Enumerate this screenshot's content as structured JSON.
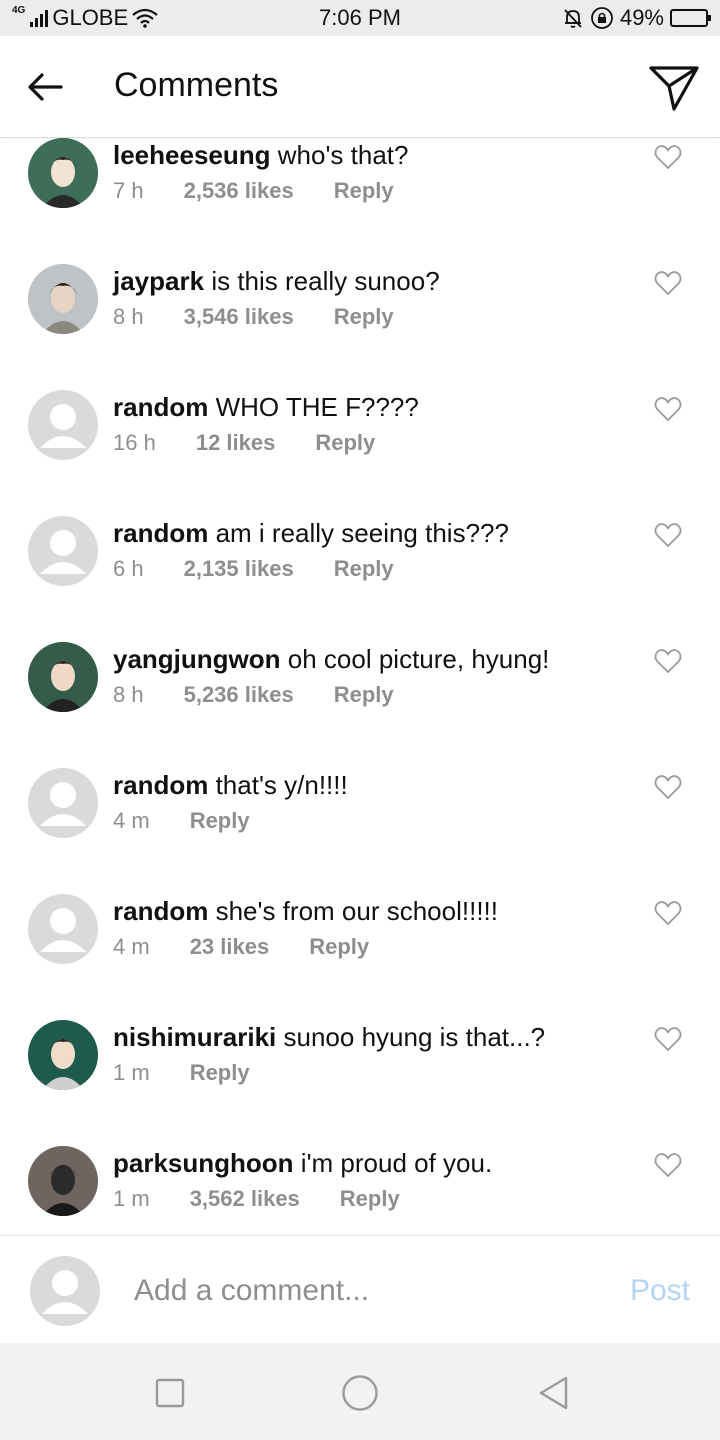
{
  "status_bar": {
    "network_type": "4G",
    "carrier": "GLOBE",
    "time": "7:06 PM",
    "battery": "49%",
    "battery_level": 0.49,
    "icons": [
      "signal-icon",
      "wifi-icon",
      "alarm-off-icon",
      "rotation-lock-icon",
      "battery-icon"
    ]
  },
  "header": {
    "title": "Comments",
    "back_icon": "arrow-left-icon",
    "send_icon": "direct-send-icon"
  },
  "comments": [
    {
      "username": "leeheeseung",
      "text": "who's that?",
      "time": "7 h",
      "likes": "2,536 likes",
      "reply": "Reply",
      "avatar": "photo-avatar"
    },
    {
      "username": "jaypark",
      "text": "is this really sunoo?",
      "time": "8 h",
      "likes": "3,546 likes",
      "reply": "Reply",
      "avatar": "photo-avatar"
    },
    {
      "username": "random",
      "text": "WHO THE F????",
      "time": "16 h",
      "likes": "12 likes",
      "reply": "Reply",
      "avatar": "default-avatar"
    },
    {
      "username": "random",
      "text": "am i really seeing this???",
      "time": "6 h",
      "likes": "2,135 likes",
      "reply": "Reply",
      "avatar": "default-avatar"
    },
    {
      "username": "yangjungwon",
      "text": "oh cool picture, hyung!",
      "time": "8 h",
      "likes": "5,236 likes",
      "reply": "Reply",
      "avatar": "photo-avatar"
    },
    {
      "username": "random",
      "text": "that's y/n!!!!",
      "time": "4 m",
      "likes": "",
      "reply": "Reply",
      "avatar": "default-avatar"
    },
    {
      "username": "random",
      "text": "she's from our school!!!!!",
      "time": "4 m",
      "likes": "23 likes",
      "reply": "Reply",
      "avatar": "default-avatar"
    },
    {
      "username": "nishimurariki",
      "text": "sunoo hyung is that...?",
      "time": "1 m",
      "likes": "",
      "reply": "Reply",
      "avatar": "photo-avatar"
    },
    {
      "username": "parksunghoon",
      "text": "i'm proud of you.",
      "time": "1 m",
      "likes": "3,562 likes",
      "reply": "Reply",
      "avatar": "photo-avatar"
    }
  ],
  "composer": {
    "placeholder": "Add a comment...",
    "post_label": "Post",
    "post_color": "#b3d4f5"
  },
  "nav_bar": {
    "icons": [
      "recents-square-icon",
      "home-circle-icon",
      "back-triangle-icon"
    ]
  },
  "colors": {
    "meta_gray": "#8e8e8e",
    "text": "#111111",
    "status_bar_bg": "#ececec",
    "nav_bar_bg": "#f2f2f2"
  }
}
